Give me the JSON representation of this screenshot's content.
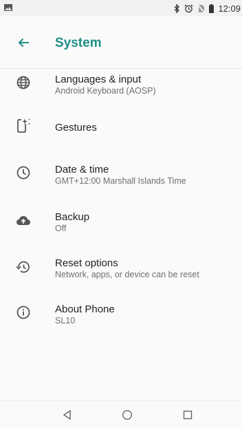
{
  "status_bar": {
    "time": "12:09",
    "icons": [
      "image-icon",
      "bluetooth-icon",
      "alarm-icon",
      "no-sim-icon",
      "battery-icon"
    ]
  },
  "header": {
    "title": "System",
    "back_icon": "arrow-back-icon",
    "accent_color": "#1e8f86"
  },
  "items": [
    {
      "title": "Languages & input",
      "subtitle": "Android Keyboard (AOSP)",
      "icon": "globe-icon"
    },
    {
      "title": "Gestures",
      "subtitle": "",
      "icon": "gestures-icon"
    },
    {
      "title": "Date & time",
      "subtitle": "GMT+12:00 Marshall Islands Time",
      "icon": "clock-icon"
    },
    {
      "title": "Backup",
      "subtitle": "Off",
      "icon": "cloud-upload-icon"
    },
    {
      "title": "Reset options",
      "subtitle": "Network, apps, or device can be reset",
      "icon": "restore-icon"
    },
    {
      "title": "About Phone",
      "subtitle": "SL10",
      "icon": "info-icon"
    }
  ],
  "nav_bar": {
    "buttons": [
      "back-triangle-icon",
      "home-circle-icon",
      "recents-square-icon"
    ]
  }
}
